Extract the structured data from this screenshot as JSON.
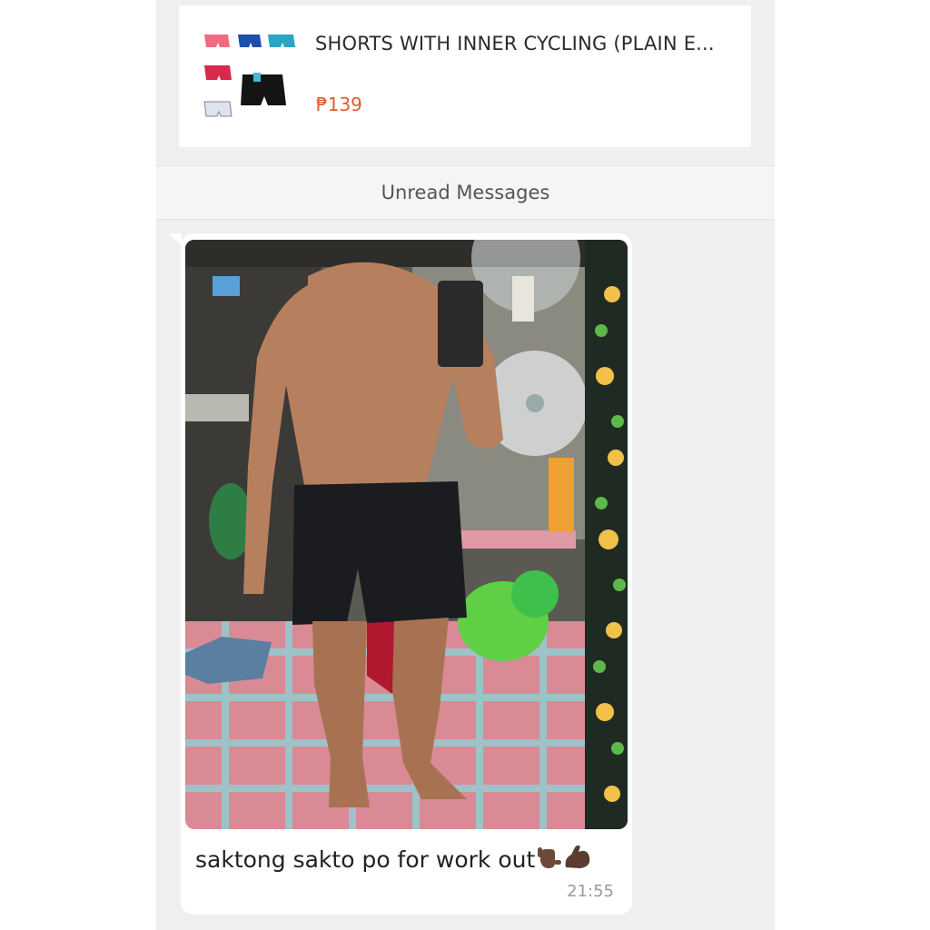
{
  "product": {
    "title": "SHORTS WITH INNER CYCLING (PLAIN E...",
    "price": "₱139",
    "thumbnail_icon": "shorts-collage-image"
  },
  "divider": {
    "label": "Unread Messages"
  },
  "message": {
    "image_icon": "mirror-selfie-photo",
    "text": "saktong sakto po for work out",
    "emojis": [
      "call-me-hand-emoji",
      "flexed-biceps-emoji"
    ],
    "time": "21:55"
  },
  "colors": {
    "background": "#efefef",
    "card": "#ffffff",
    "price": "#e05a33",
    "text": "#222222",
    "timestamp": "#9a9a9a"
  }
}
